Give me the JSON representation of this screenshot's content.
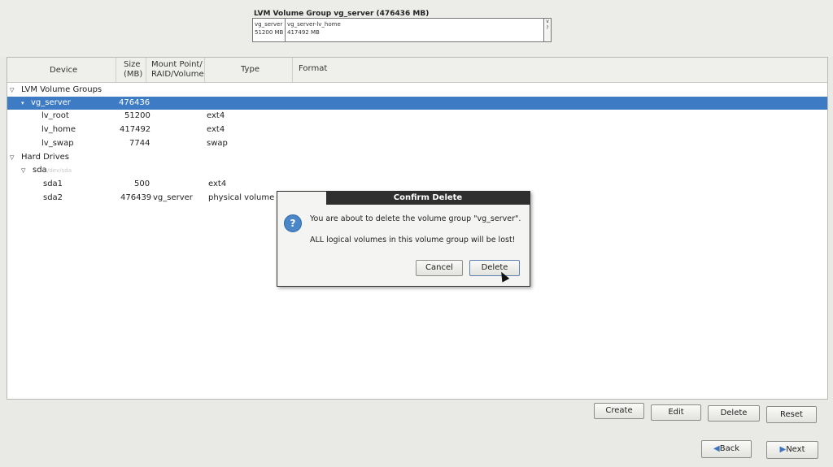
{
  "vg_header": {
    "title": "LVM Volume Group vg_server (476436 MB)",
    "segments": [
      {
        "name": "vg_server",
        "size": "51200 MB"
      },
      {
        "name": "vg_server-lv_home",
        "size": "417492 MB"
      }
    ],
    "scroll_glyphs": [
      "v",
      "?"
    ]
  },
  "columns": {
    "device": "Device",
    "size_l1": "Size",
    "size_l2": "(MB)",
    "mount_l1": "Mount Point/",
    "mount_l2": "RAID/Volume",
    "type": "Type",
    "format": "Format"
  },
  "rows": [
    {
      "device": "LVM Volume Groups",
      "size": "",
      "mount": "",
      "type": "",
      "kind": "group"
    },
    {
      "device": "vg_server",
      "size": "476436",
      "mount": "",
      "type": "",
      "kind": "selected"
    },
    {
      "device": "lv_root",
      "size": "51200",
      "mount": "",
      "type": "ext4",
      "kind": "child"
    },
    {
      "device": "lv_home",
      "size": "417492",
      "mount": "",
      "type": "ext4",
      "kind": "child"
    },
    {
      "device": "lv_swap",
      "size": "7744",
      "mount": "",
      "type": "swap",
      "kind": "child"
    },
    {
      "device": "Hard Drives",
      "size": "",
      "mount": "",
      "type": "",
      "kind": "group"
    },
    {
      "device": "sda",
      "size": "",
      "mount": "",
      "type": "",
      "kind": "disk",
      "extra": "/dev/sda"
    },
    {
      "device": "sda1",
      "size": "500",
      "mount": "",
      "type": "ext4",
      "kind": "child"
    },
    {
      "device": "sda2",
      "size": "476439",
      "mount": "vg_server",
      "type": "physical volume (",
      "kind": "child"
    }
  ],
  "dialog": {
    "title": "Confirm Delete",
    "icon": "question-icon",
    "message": "You are about to delete the volume group \"vg_server\".",
    "detail": "ALL logical volumes in this volume group will be lost!",
    "cancel": "Cancel",
    "delete": "Delete"
  },
  "actions": {
    "create": "Create",
    "edit": "Edit",
    "delete": "Delete",
    "reset": "Reset"
  },
  "nav": {
    "back": "Back",
    "next": "Next"
  },
  "colors": {
    "selection": "#3d7bc4",
    "dialog_title_bg": "#2f2f2f",
    "background": "#e9e9e6"
  }
}
